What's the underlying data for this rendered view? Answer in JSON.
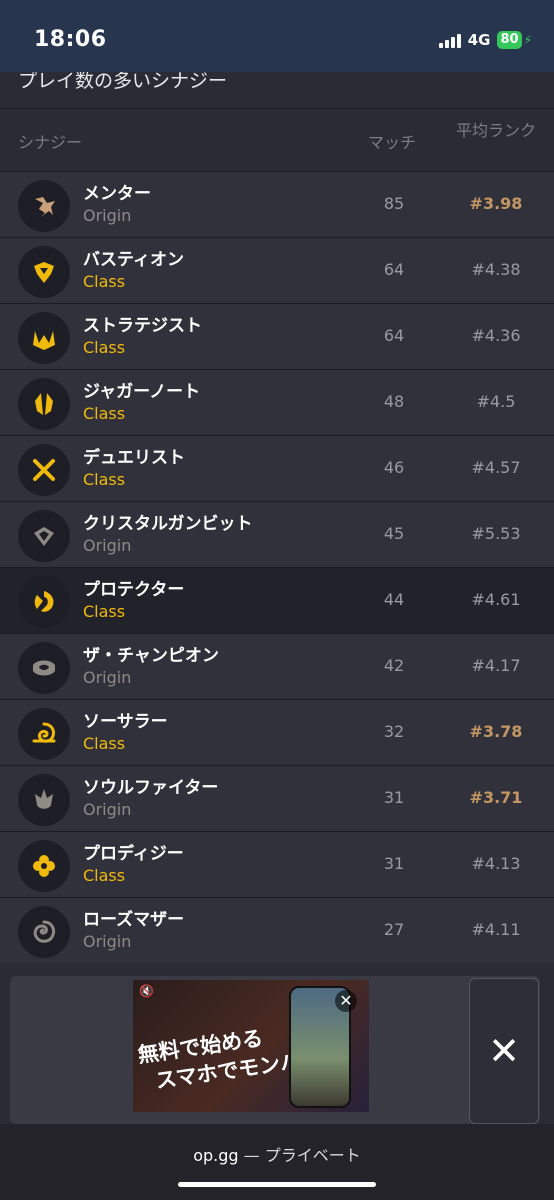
{
  "status_bar": {
    "time": "18:06",
    "network": "4G",
    "battery": "80"
  },
  "section_title": "プレイ数の多いシナジー",
  "table": {
    "headers": {
      "synergy": "シナジー",
      "matches": "マッチ",
      "avg_rank": "平均ランク"
    },
    "rows": [
      {
        "name": "メンター",
        "type": "Origin",
        "matches": "85",
        "rank": "#3.98",
        "highlight": true,
        "icon": "mentor-icon"
      },
      {
        "name": "バスティオン",
        "type": "Class",
        "matches": "64",
        "rank": "#4.38",
        "highlight": false,
        "icon": "bastion-icon"
      },
      {
        "name": "ストラテジスト",
        "type": "Class",
        "matches": "64",
        "rank": "#4.36",
        "highlight": false,
        "icon": "strategist-icon"
      },
      {
        "name": "ジャガーノート",
        "type": "Class",
        "matches": "48",
        "rank": "#4.5",
        "highlight": false,
        "icon": "juggernaut-icon"
      },
      {
        "name": "デュエリスト",
        "type": "Class",
        "matches": "46",
        "rank": "#4.57",
        "highlight": false,
        "icon": "duelist-icon"
      },
      {
        "name": "クリスタルガンビット",
        "type": "Origin",
        "matches": "45",
        "rank": "#5.53",
        "highlight": false,
        "icon": "crystal-gambit-icon"
      },
      {
        "name": "プロテクター",
        "type": "Class",
        "matches": "44",
        "rank": "#4.61",
        "highlight": false,
        "icon": "protector-icon"
      },
      {
        "name": "ザ・チャンピオン",
        "type": "Origin",
        "matches": "42",
        "rank": "#4.17",
        "highlight": false,
        "icon": "champion-icon"
      },
      {
        "name": "ソーサラー",
        "type": "Class",
        "matches": "32",
        "rank": "#3.78",
        "highlight": true,
        "icon": "sorcerer-icon"
      },
      {
        "name": "ソウルファイター",
        "type": "Origin",
        "matches": "31",
        "rank": "#3.71",
        "highlight": true,
        "icon": "soul-fighter-icon"
      },
      {
        "name": "プロディジー",
        "type": "Class",
        "matches": "31",
        "rank": "#4.13",
        "highlight": false,
        "icon": "prodigy-icon"
      },
      {
        "name": "ローズマザー",
        "type": "Origin",
        "matches": "27",
        "rank": "#4.11",
        "highlight": false,
        "icon": "rosemother-icon"
      }
    ]
  },
  "ad": {
    "line1": "無料で始める",
    "line2": "スマホでモンハン!"
  },
  "bottom_bar": {
    "domain": "op.gg",
    "suffix": " — プライベート"
  },
  "colors": {
    "class": "#f0b90b",
    "origin": "#8e8a84",
    "highlight_rank": "#c49762"
  }
}
